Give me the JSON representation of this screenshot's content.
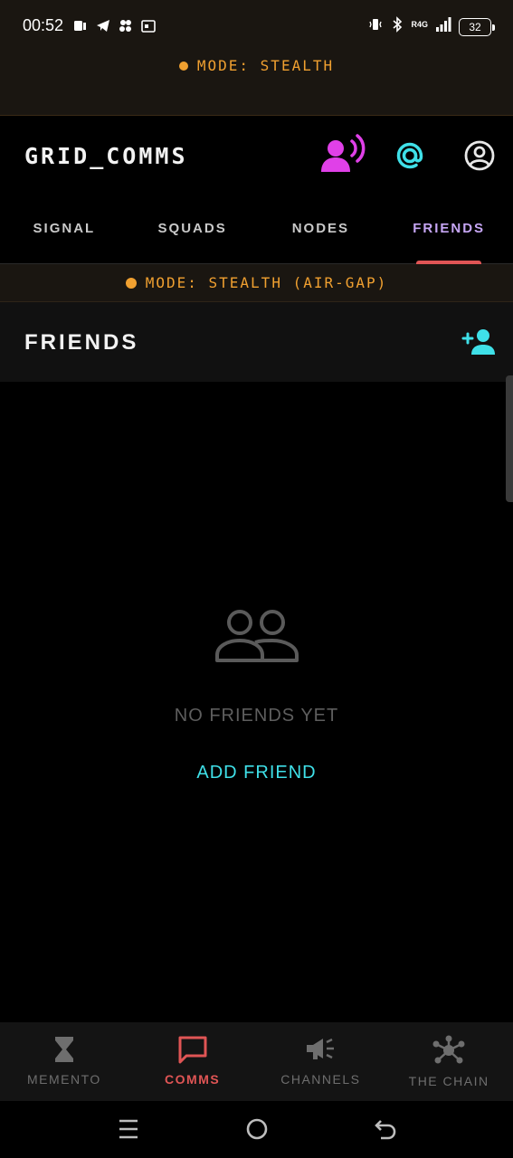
{
  "status_bar": {
    "time": "00:52",
    "network": "R4G",
    "battery": "32"
  },
  "mode_banner": {
    "label": "MODE: STEALTH"
  },
  "app_bar": {
    "title": "GRID_COMMS"
  },
  "tabs": [
    {
      "label": "SIGNAL",
      "active": false
    },
    {
      "label": "SQUADS",
      "active": false
    },
    {
      "label": "NODES",
      "active": false
    },
    {
      "label": "FRIENDS",
      "active": true
    }
  ],
  "mode_strip": {
    "label": "MODE: STEALTH (AIR-GAP)"
  },
  "section": {
    "title": "FRIENDS"
  },
  "empty_state": {
    "message": "NO FRIENDS YET",
    "action": "ADD FRIEND"
  },
  "bottom_nav": [
    {
      "label": "MEMENTO",
      "icon": "hourglass-icon",
      "active": false
    },
    {
      "label": "COMMS",
      "icon": "chat-icon",
      "active": true
    },
    {
      "label": "CHANNELS",
      "icon": "megaphone-icon",
      "active": false
    },
    {
      "label": "THE CHAIN",
      "icon": "network-icon",
      "active": false
    }
  ],
  "colors": {
    "accent_cyan": "#3fe0e8",
    "accent_magenta": "#e040e8",
    "active_red": "#e05555",
    "active_tab_purple": "#c6a6f4",
    "mode_amber": "#f0a030"
  }
}
